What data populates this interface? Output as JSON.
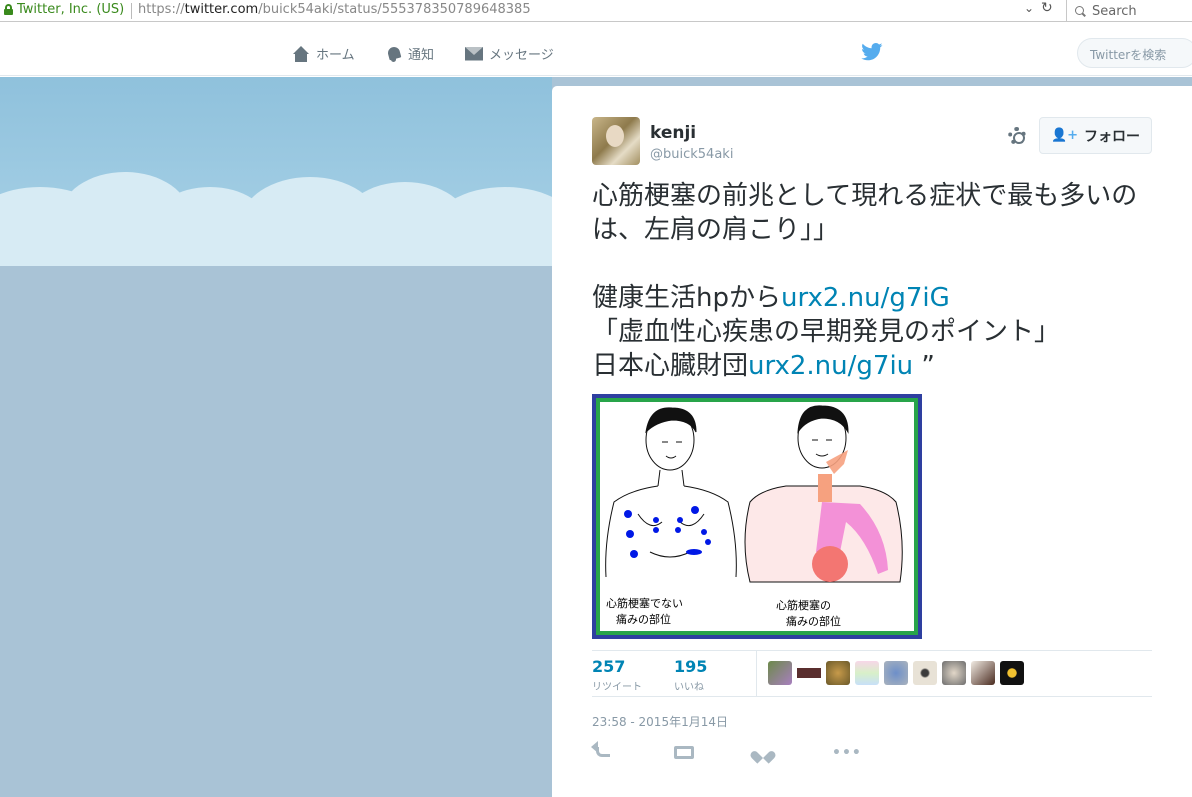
{
  "browser": {
    "site_identity": "Twitter, Inc. (US)",
    "url_prefix": "https://",
    "url_domain": "twitter.com",
    "url_path": "/buick54aki/status/555378350789648385",
    "search_placeholder": "Search"
  },
  "nav": {
    "home": "ホーム",
    "notifications": "通知",
    "messages": "メッセージ",
    "search_placeholder": "Twitterを検索"
  },
  "tweet": {
    "name": "kenji",
    "handle": "@buick54aki",
    "follow_label": "フォロー",
    "text_line1": "心筋梗塞の前兆として現れる症状で最も多いのは、左肩の肩こり」」",
    "text_line2_prefix": "健康生活hpから",
    "link1": "urx2.nu/g7iG",
    "text_line3": "「虚血性心疾患の早期発見のポイント」",
    "text_line4_prefix": "日本心臓財団",
    "link2": "urx2.nu/g7iu",
    "text_line4_suffix": " ”",
    "image_caption_left_1": "心筋梗塞でない",
    "image_caption_left_2": "痛みの部位",
    "image_caption_right_1": "心筋梗塞の",
    "image_caption_right_2": "痛みの部位",
    "retweets": "257",
    "retweets_label": "リツイート",
    "likes": "195",
    "likes_label": "いいね",
    "timestamp": "23:58 - 2015年1月14日"
  },
  "colors": {
    "link": "#0084b4",
    "secure_green": "#3a8a1d",
    "twitter_blue": "#55acee"
  }
}
